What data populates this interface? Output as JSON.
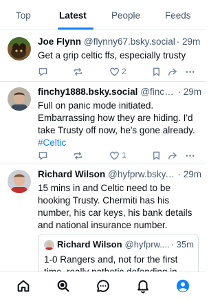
{
  "tabs": [
    {
      "label": "Top",
      "active": false
    },
    {
      "label": "Latest",
      "active": true
    },
    {
      "label": "People",
      "active": false
    },
    {
      "label": "Feeds",
      "active": false
    }
  ],
  "posts": [
    {
      "name": "Joe Flynn",
      "handle": "@flynny67.bsky.social",
      "time": "· 29m",
      "text": "Get a grip celtic ffs, especially trusty",
      "likes": "2"
    },
    {
      "name": "finchy1888.bsky.social",
      "handle": "@finchy...",
      "time": "· 29m",
      "text": "Full on panic mode initiated. Embarrassing how they are hiding. I'd take Trusty off now, he's gone already.",
      "hashtag": "#Celtic",
      "likes": "1"
    },
    {
      "name": "Richard Wilson",
      "handle": "@hyfprw.bsky.s...",
      "time": "· 29m",
      "text": "15 mins in and Celtic need to be hooking Trusty. Chermiti has his number, his car keys, his bank details and national insurance number.",
      "quote": {
        "name": "Richard Wilson",
        "handle": "@hyfprw....",
        "time": "· 35m",
        "text": "1-0 Rangers and, not for the first time, really pathetic defending in"
      }
    }
  ],
  "icons": {
    "reply": "reply-icon",
    "repost": "repost-icon",
    "like": "heart-icon",
    "bookmark": "bookmark-icon",
    "share": "share-icon",
    "more": "more-icon"
  },
  "nav": [
    "home-icon",
    "search-icon",
    "chat-icon",
    "bell-icon",
    "profile-icon"
  ],
  "colors": {
    "accent": "#1083fe",
    "muted": "#6f869f",
    "border": "#e4e8ec"
  }
}
